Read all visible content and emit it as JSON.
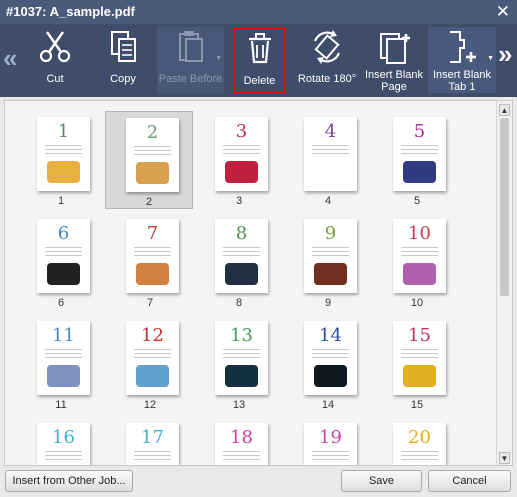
{
  "window": {
    "title": "#1037: A_sample.pdf",
    "close_icon": "close-icon"
  },
  "toolbar": {
    "scroll_left": "«",
    "scroll_right": "»",
    "buttons": [
      {
        "id": "cut",
        "label": "Cut",
        "icon": "scissors-icon",
        "enabled": true
      },
      {
        "id": "copy",
        "label": "Copy",
        "icon": "copy-icon",
        "enabled": true
      },
      {
        "id": "paste_before",
        "label": "Paste Before",
        "icon": "paste-icon",
        "enabled": false
      },
      {
        "id": "delete",
        "label": "Delete",
        "icon": "trash-icon",
        "enabled": true,
        "selected": true
      },
      {
        "id": "rotate",
        "label": "Rotate 180°",
        "icon": "rotate-icon",
        "enabled": true
      },
      {
        "id": "insert_blank_page",
        "label": "Insert Blank Page",
        "icon": "insert-page-icon",
        "enabled": true
      },
      {
        "id": "insert_blank_tab",
        "label": "Insert Blank Tab 1",
        "icon": "insert-tab-icon",
        "enabled": true
      }
    ]
  },
  "pages": [
    {
      "num": "1",
      "caption": "1",
      "color": "#5a8a6a",
      "art": "#e8b040"
    },
    {
      "num": "2",
      "caption": "2",
      "color": "#6a9a70",
      "art": "#d9a050",
      "selected": true
    },
    {
      "num": "3",
      "caption": "3",
      "color": "#b8304a",
      "art": "#c02040"
    },
    {
      "num": "4",
      "caption": "4",
      "color": "#7a4aa0",
      "art": ""
    },
    {
      "num": "5",
      "caption": "5",
      "color": "#a0309a",
      "art": "#303a80"
    },
    {
      "num": "6",
      "caption": "6",
      "color": "#4a8ac0",
      "art": "#222222"
    },
    {
      "num": "7",
      "caption": "7",
      "color": "#b84040",
      "art": "#d08040"
    },
    {
      "num": "8",
      "caption": "8",
      "color": "#4a9a4a",
      "art": "#203040"
    },
    {
      "num": "9",
      "caption": "9",
      "color": "#7aa040",
      "art": "#703020"
    },
    {
      "num": "10",
      "caption": "10",
      "color": "#c04050",
      "art": "#b060b0"
    },
    {
      "num": "11",
      "caption": "11",
      "color": "#4a8ac0",
      "art": "#8090c0"
    },
    {
      "num": "12",
      "caption": "12",
      "color": "#c03030",
      "art": "#60a0d0"
    },
    {
      "num": "13",
      "caption": "13",
      "color": "#40a060",
      "art": "#103040"
    },
    {
      "num": "14",
      "caption": "14",
      "color": "#304a9a",
      "art": "#101820"
    },
    {
      "num": "15",
      "caption": "15",
      "color": "#c03060",
      "art": "#e0b020"
    },
    {
      "num": "16",
      "caption": "",
      "color": "#40b0d0",
      "art": ""
    },
    {
      "num": "17",
      "caption": "",
      "color": "#40b0d0",
      "art": ""
    },
    {
      "num": "18",
      "caption": "",
      "color": "#d040a0",
      "art": ""
    },
    {
      "num": "19",
      "caption": "",
      "color": "#d040b0",
      "art": ""
    },
    {
      "num": "20",
      "caption": "",
      "color": "#e0b020",
      "art": ""
    }
  ],
  "footer": {
    "insert_other": "Insert from Other Job...",
    "save": "Save",
    "cancel": "Cancel"
  }
}
